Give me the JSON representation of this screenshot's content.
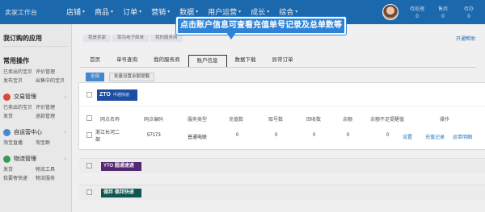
{
  "brand": "卖家工作台",
  "nav": [
    {
      "label": "店铺"
    },
    {
      "label": "商品"
    },
    {
      "label": "订单"
    },
    {
      "label": "营销"
    },
    {
      "label": "数据"
    },
    {
      "label": "用户运营"
    },
    {
      "label": "成长"
    },
    {
      "label": "综合"
    }
  ],
  "header_stats": [
    {
      "label": "待处理",
      "value": "0"
    },
    {
      "label": "售后",
      "value": "0"
    },
    {
      "label": "待办",
      "value": "0"
    }
  ],
  "sidebar": {
    "title": "我订购的应用",
    "common_title": "常用操作",
    "common_links": [
      "已卖出的宝贝",
      "评价管理",
      "发布宝贝",
      "出售中的宝贝"
    ],
    "groups": [
      {
        "label": "交易管理",
        "links": [
          "已卖出的宝贝",
          "评价管理",
          "发货",
          "退款管理"
        ],
        "color": "#e84a3c"
      },
      {
        "label": "自运营中心",
        "links": [
          "淘宝直播",
          "淘宝群"
        ],
        "color": "#4a90d9"
      },
      {
        "label": "物流管理",
        "links": [
          "发货",
          "物流工具",
          "我要寄快递",
          "物流服务"
        ],
        "color": "#3aa65a"
      }
    ]
  },
  "breadcrumb": [
    "我是卖家",
    "菜鸟电子面单",
    "我的服务商"
  ],
  "help_link": "开通帮助",
  "tabs": [
    "首页",
    "单号查询",
    "我的服务商",
    "账户信息",
    "数据下载",
    "异常订单"
  ],
  "active_tab": "账户信息",
  "filters": [
    "全部",
    "批量设置余额提醒"
  ],
  "callout": "点击账户信息可查看充值单号记录及总单数等",
  "carrier": {
    "logo_text": "ZTO",
    "logo_sub": "中通快递"
  },
  "table": {
    "headers": [
      "网点名称",
      "网点编码",
      "服务类型",
      "充值数",
      "取号数",
      "回收数",
      "余额",
      "余额不足提醒值",
      "操作"
    ],
    "row": {
      "name": "浙江长河二部",
      "code": "57173",
      "service": "普通电联",
      "recharge": "0",
      "taken": "0",
      "recycled": "0",
      "balance": "0",
      "alert": "0",
      "actions": [
        "设置",
        "充值记录",
        "运单明细"
      ]
    }
  },
  "other_carriers": [
    {
      "logo_text": "YTO",
      "logo_sub": "圆通速递"
    },
    {
      "logo_text": "德邦",
      "logo_sub": "德邦快递"
    }
  ]
}
